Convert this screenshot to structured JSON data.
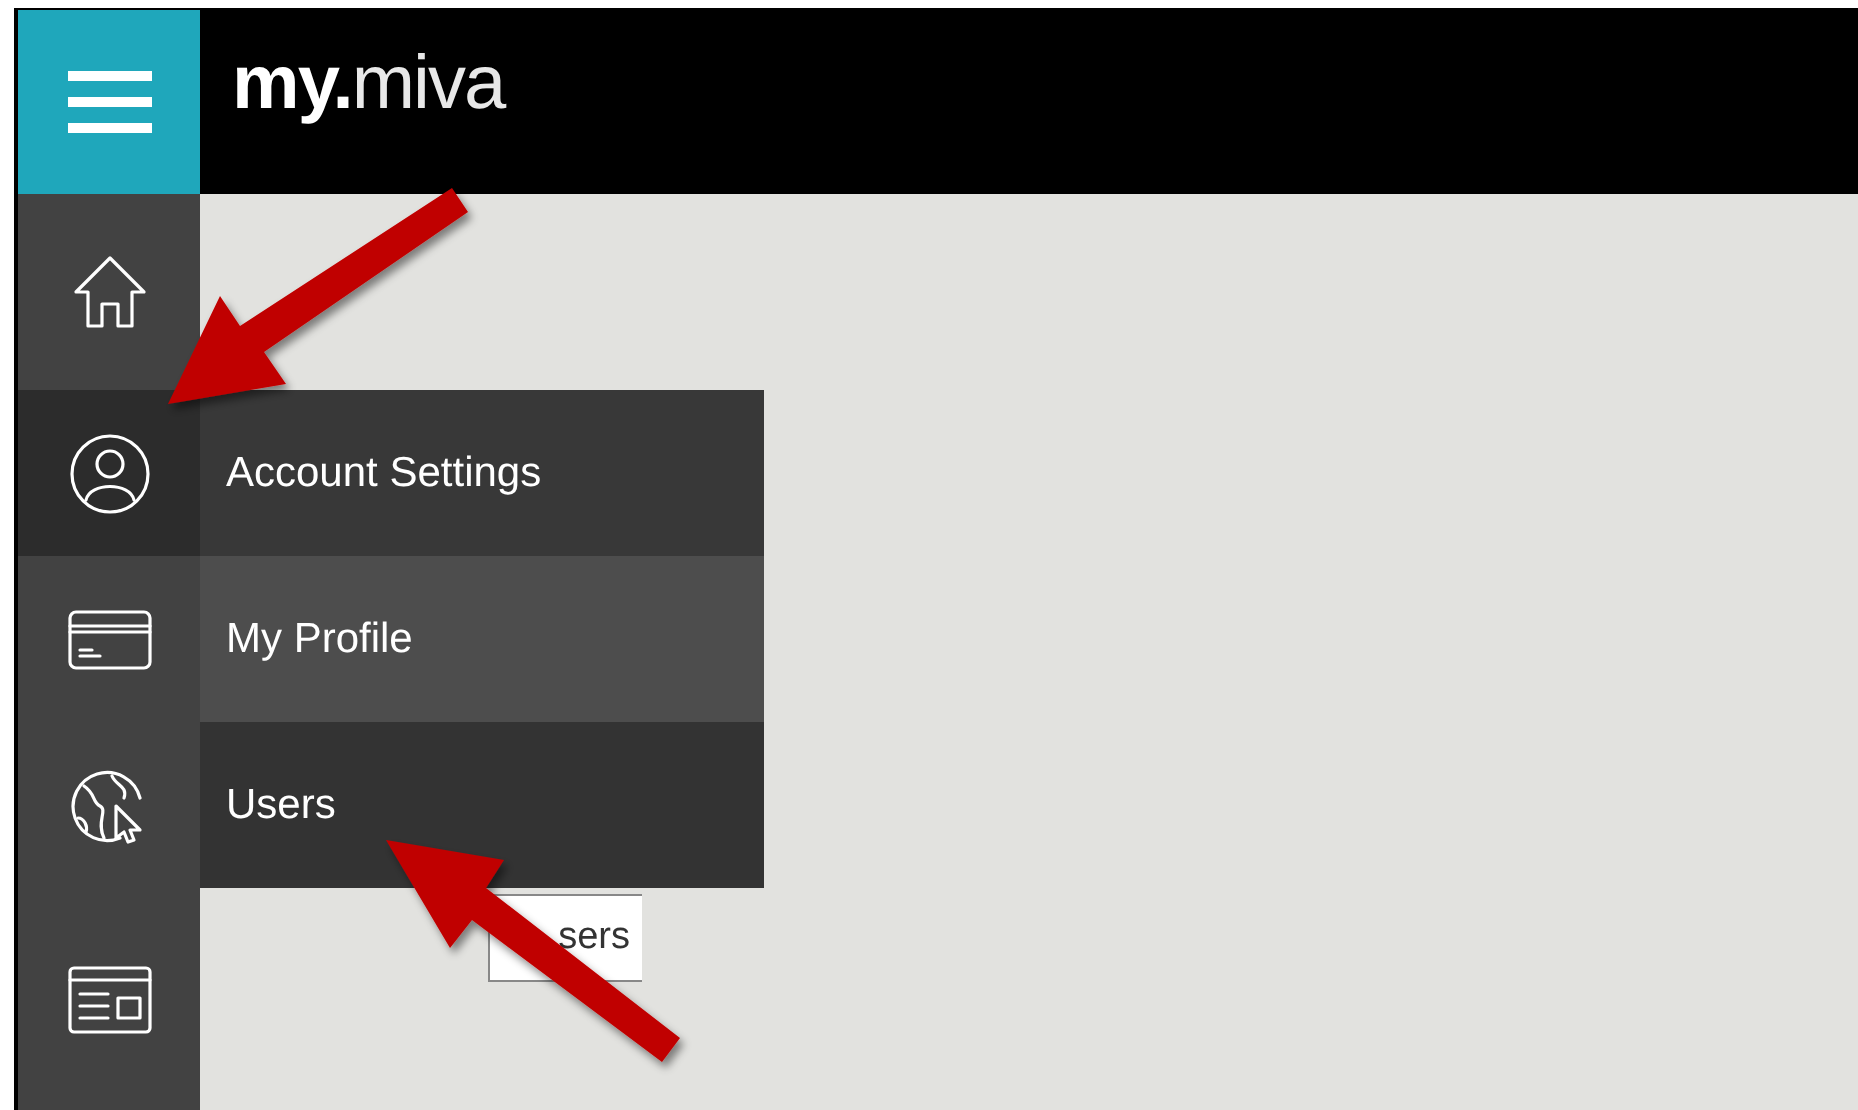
{
  "header": {
    "logo_bold": "my.",
    "logo_light": "miva"
  },
  "sidebar": {
    "items": [
      {
        "kind": "home",
        "selected": false
      },
      {
        "kind": "account",
        "selected": true
      },
      {
        "kind": "card",
        "selected": false
      },
      {
        "kind": "globe",
        "selected": false
      },
      {
        "kind": "browser",
        "selected": false
      }
    ]
  },
  "flyout": {
    "title": "Account Settings",
    "items": [
      {
        "label": "My Profile",
        "highlighted": true
      },
      {
        "label": "Users",
        "highlighted": false
      }
    ]
  },
  "tooltip": {
    "text": "sers"
  }
}
